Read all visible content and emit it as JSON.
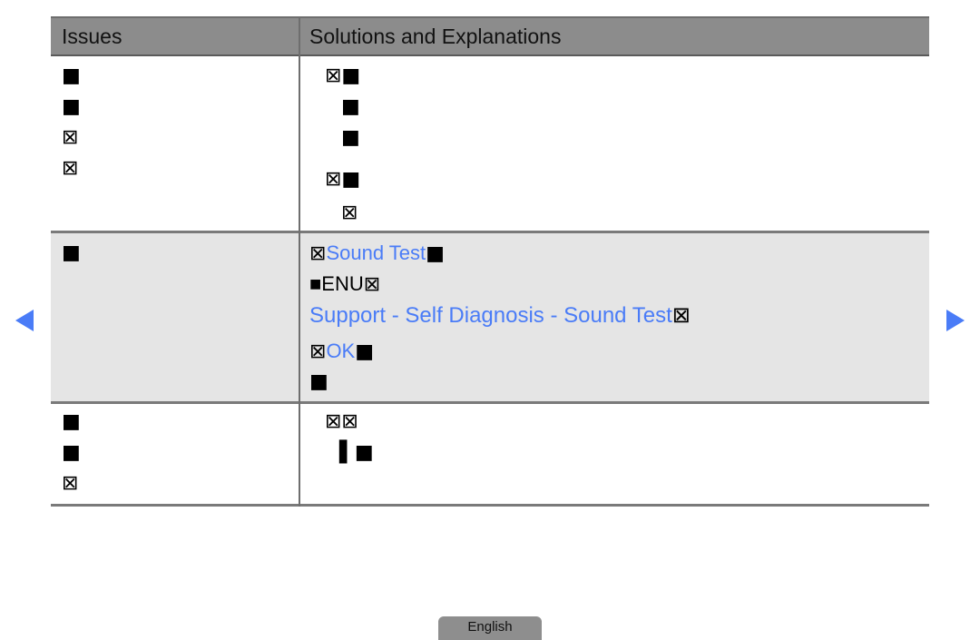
{
  "table": {
    "headers": [
      "Issues",
      "Solutions and Explanations"
    ],
    "rows": [
      {
        "issue_lines": [
          "■",
          "■",
          "⊠",
          "⊠"
        ],
        "solution_lines": [
          "⊠■",
          "■",
          "■",
          "⊠■",
          "⊠"
        ]
      },
      {
        "issue_lines": [
          "■"
        ],
        "solution_lines": [
          {
            "prefix": "⊠",
            "link": "Sound Test",
            "suffix": "■"
          },
          {
            "prefix": "■ENU⊠",
            "link": "",
            "suffix": ""
          },
          {
            "prefix": "",
            "link": "Support - Self Diagnosis - Sound Test",
            "suffix": "⊠"
          },
          {
            "prefix": "⊠",
            "link": "OK",
            "suffix": "■"
          },
          {
            "prefix": "■",
            "link": "",
            "suffix": ""
          }
        ]
      },
      {
        "issue_lines": [
          "■",
          "■",
          "⊠"
        ],
        "solution_lines": [
          "⊠⊠",
          "▌■"
        ]
      }
    ]
  },
  "nav": {
    "prev_icon": "triangle-left",
    "next_icon": "triangle-right",
    "accent_color": "#4a7cf7"
  },
  "language_tab": {
    "label": "English"
  }
}
